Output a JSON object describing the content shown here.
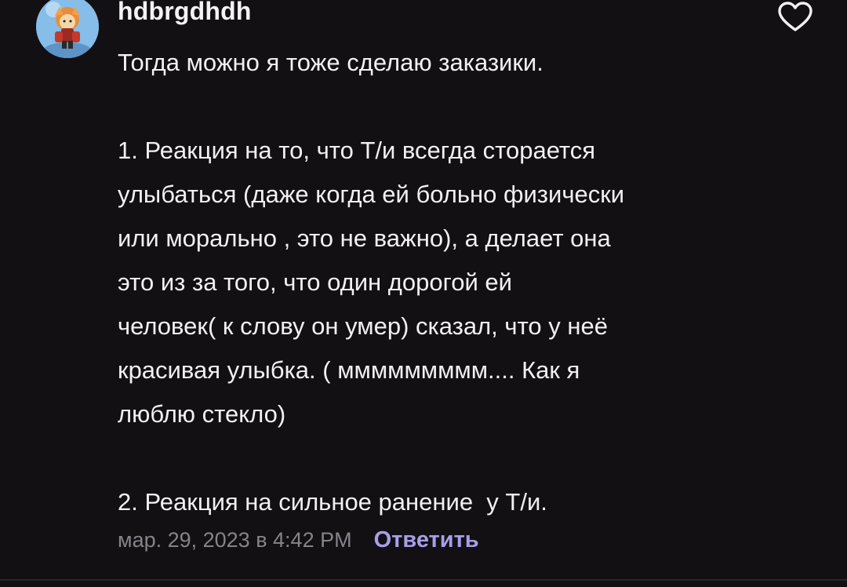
{
  "comment": {
    "username": "hdbrgdhdh",
    "lines": [
      "Тогда можно я тоже сделаю заказики.",
      "",
      "1. Реакция на то, что Т/и всегда сторается",
      "улыбаться (даже когда ей больно физически",
      "или морально , это не важно), а делает она",
      "это из за того, что один дорогой ей",
      "человек( к слову он умер) сказал, что у неё",
      "красивая улыбка. ( ммммммммм.... Как я",
      "люблю стекло)",
      "",
      "2. Реакция на сильное ранение  у Т/и."
    ],
    "timestamp": "мар. 29, 2023 в 4:42 PM",
    "reply_label": "Ответить"
  },
  "icons": {
    "like": "heart-outline-icon",
    "avatar": "user-avatar"
  },
  "colors": {
    "background": "#121013",
    "text": "#f2f0f3",
    "muted": "#86838a",
    "accent": "#a79fe9"
  }
}
